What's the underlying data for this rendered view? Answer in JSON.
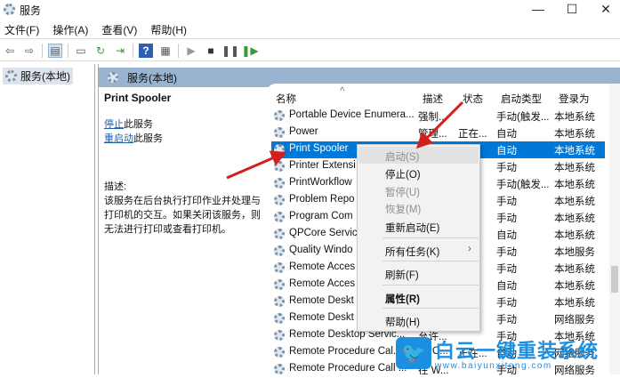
{
  "window": {
    "title": "服务",
    "minimize": "—",
    "maximize": "☐",
    "close": "✕"
  },
  "menu": [
    "文件(F)",
    "操作(A)",
    "查看(V)",
    "帮助(H)"
  ],
  "tree": {
    "root": "服务(本地)"
  },
  "band": {
    "title": "服务(本地)"
  },
  "detail": {
    "service_name": "Print Spooler",
    "stop_link": "停止",
    "stop_suffix": "此服务",
    "restart_link": "重启动",
    "restart_suffix": "此服务",
    "desc_label": "描述:",
    "description": "该服务在后台执行打印作业并处理与打印机的交互。如果关闭该服务，则无法进行打印或查看打印机。"
  },
  "columns": [
    "名称",
    "描述",
    "状态",
    "启动类型",
    "登录为"
  ],
  "rows": [
    {
      "name": "Portable Device Enumera...",
      "desc": "强制...",
      "status": "",
      "start": "手动(触发...",
      "logon": "本地系统"
    },
    {
      "name": "Power",
      "desc": "管理...",
      "status": "正在...",
      "start": "自动",
      "logon": "本地系统"
    },
    {
      "name": "Print Spooler",
      "desc": "",
      "status": "...",
      "start": "自动",
      "logon": "本地系统"
    },
    {
      "name": "Printer Extensi",
      "desc": "",
      "status": "",
      "start": "手动",
      "logon": "本地系统"
    },
    {
      "name": "PrintWorkflow",
      "desc": "",
      "status": "...",
      "start": "手动(触发...",
      "logon": "本地系统"
    },
    {
      "name": "Problem Repo",
      "desc": "",
      "status": "",
      "start": "手动",
      "logon": "本地系统"
    },
    {
      "name": "Program Com",
      "desc": "",
      "status": "...",
      "start": "手动",
      "logon": "本地系统"
    },
    {
      "name": "QPCore Servic",
      "desc": "",
      "status": "...",
      "start": "自动",
      "logon": "本地系统"
    },
    {
      "name": "Quality Windo",
      "desc": "",
      "status": "",
      "start": "手动",
      "logon": "本地服务"
    },
    {
      "name": "Remote Acces",
      "desc": "",
      "status": "",
      "start": "手动",
      "logon": "本地系统"
    },
    {
      "name": "Remote Acces",
      "desc": "",
      "status": "...",
      "start": "自动",
      "logon": "本地系统"
    },
    {
      "name": "Remote Deskt",
      "desc": "",
      "status": "",
      "start": "手动",
      "logon": "本地系统"
    },
    {
      "name": "Remote Deskt",
      "desc": "",
      "status": "",
      "start": "手动",
      "logon": "网络服务"
    },
    {
      "name": "Remote Desktop Servic...",
      "desc": "允许...",
      "status": "",
      "start": "手动",
      "logon": "本地系统"
    },
    {
      "name": "Remote Procedure Cal...",
      "desc": "RPC...",
      "status": "正在...",
      "start": "自动",
      "logon": "网络服务"
    },
    {
      "name": "Remote Procedure Call ...",
      "desc": "在 W...",
      "status": "",
      "start": "手动",
      "logon": "网络服务"
    }
  ],
  "context_menu": {
    "start": "启动(S)",
    "stop": "停止(O)",
    "pause": "暂停(U)",
    "resume": "恢复(M)",
    "restart": "重新启动(E)",
    "all_tasks": "所有任务(K)",
    "refresh": "刷新(F)",
    "properties": "属性(R)",
    "help": "帮助(H)"
  },
  "watermark": {
    "title": "白云一键重装系统",
    "url": "www.baiyunxitong.com"
  },
  "colors": {
    "selection": "#0078d7",
    "band": "#99b4d1",
    "arrow": "#d21f1f",
    "watermark": "#1d8fe1"
  }
}
